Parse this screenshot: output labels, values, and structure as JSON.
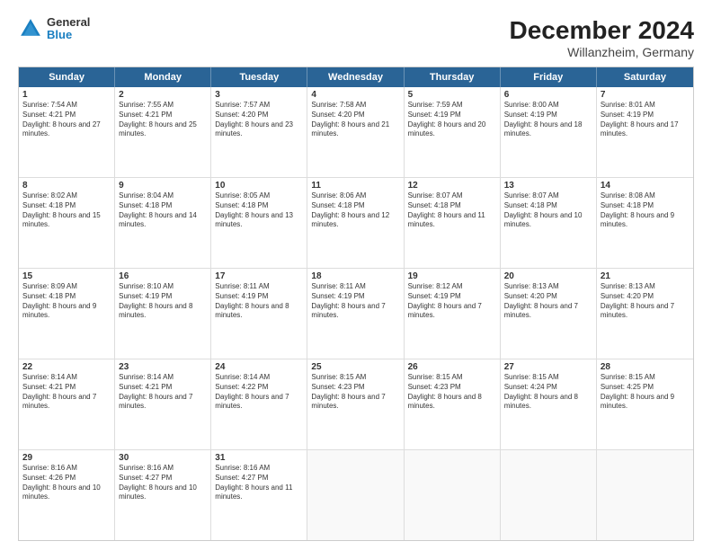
{
  "header": {
    "logo_general": "General",
    "logo_blue": "Blue",
    "title": "December 2024",
    "subtitle": "Willanzheim, Germany"
  },
  "days_of_week": [
    "Sunday",
    "Monday",
    "Tuesday",
    "Wednesday",
    "Thursday",
    "Friday",
    "Saturday"
  ],
  "weeks": [
    [
      {
        "day": "1",
        "sunrise": "Sunrise: 7:54 AM",
        "sunset": "Sunset: 4:21 PM",
        "daylight": "Daylight: 8 hours and 27 minutes."
      },
      {
        "day": "2",
        "sunrise": "Sunrise: 7:55 AM",
        "sunset": "Sunset: 4:21 PM",
        "daylight": "Daylight: 8 hours and 25 minutes."
      },
      {
        "day": "3",
        "sunrise": "Sunrise: 7:57 AM",
        "sunset": "Sunset: 4:20 PM",
        "daylight": "Daylight: 8 hours and 23 minutes."
      },
      {
        "day": "4",
        "sunrise": "Sunrise: 7:58 AM",
        "sunset": "Sunset: 4:20 PM",
        "daylight": "Daylight: 8 hours and 21 minutes."
      },
      {
        "day": "5",
        "sunrise": "Sunrise: 7:59 AM",
        "sunset": "Sunset: 4:19 PM",
        "daylight": "Daylight: 8 hours and 20 minutes."
      },
      {
        "day": "6",
        "sunrise": "Sunrise: 8:00 AM",
        "sunset": "Sunset: 4:19 PM",
        "daylight": "Daylight: 8 hours and 18 minutes."
      },
      {
        "day": "7",
        "sunrise": "Sunrise: 8:01 AM",
        "sunset": "Sunset: 4:19 PM",
        "daylight": "Daylight: 8 hours and 17 minutes."
      }
    ],
    [
      {
        "day": "8",
        "sunrise": "Sunrise: 8:02 AM",
        "sunset": "Sunset: 4:18 PM",
        "daylight": "Daylight: 8 hours and 15 minutes."
      },
      {
        "day": "9",
        "sunrise": "Sunrise: 8:04 AM",
        "sunset": "Sunset: 4:18 PM",
        "daylight": "Daylight: 8 hours and 14 minutes."
      },
      {
        "day": "10",
        "sunrise": "Sunrise: 8:05 AM",
        "sunset": "Sunset: 4:18 PM",
        "daylight": "Daylight: 8 hours and 13 minutes."
      },
      {
        "day": "11",
        "sunrise": "Sunrise: 8:06 AM",
        "sunset": "Sunset: 4:18 PM",
        "daylight": "Daylight: 8 hours and 12 minutes."
      },
      {
        "day": "12",
        "sunrise": "Sunrise: 8:07 AM",
        "sunset": "Sunset: 4:18 PM",
        "daylight": "Daylight: 8 hours and 11 minutes."
      },
      {
        "day": "13",
        "sunrise": "Sunrise: 8:07 AM",
        "sunset": "Sunset: 4:18 PM",
        "daylight": "Daylight: 8 hours and 10 minutes."
      },
      {
        "day": "14",
        "sunrise": "Sunrise: 8:08 AM",
        "sunset": "Sunset: 4:18 PM",
        "daylight": "Daylight: 8 hours and 9 minutes."
      }
    ],
    [
      {
        "day": "15",
        "sunrise": "Sunrise: 8:09 AM",
        "sunset": "Sunset: 4:18 PM",
        "daylight": "Daylight: 8 hours and 9 minutes."
      },
      {
        "day": "16",
        "sunrise": "Sunrise: 8:10 AM",
        "sunset": "Sunset: 4:19 PM",
        "daylight": "Daylight: 8 hours and 8 minutes."
      },
      {
        "day": "17",
        "sunrise": "Sunrise: 8:11 AM",
        "sunset": "Sunset: 4:19 PM",
        "daylight": "Daylight: 8 hours and 8 minutes."
      },
      {
        "day": "18",
        "sunrise": "Sunrise: 8:11 AM",
        "sunset": "Sunset: 4:19 PM",
        "daylight": "Daylight: 8 hours and 7 minutes."
      },
      {
        "day": "19",
        "sunrise": "Sunrise: 8:12 AM",
        "sunset": "Sunset: 4:19 PM",
        "daylight": "Daylight: 8 hours and 7 minutes."
      },
      {
        "day": "20",
        "sunrise": "Sunrise: 8:13 AM",
        "sunset": "Sunset: 4:20 PM",
        "daylight": "Daylight: 8 hours and 7 minutes."
      },
      {
        "day": "21",
        "sunrise": "Sunrise: 8:13 AM",
        "sunset": "Sunset: 4:20 PM",
        "daylight": "Daylight: 8 hours and 7 minutes."
      }
    ],
    [
      {
        "day": "22",
        "sunrise": "Sunrise: 8:14 AM",
        "sunset": "Sunset: 4:21 PM",
        "daylight": "Daylight: 8 hours and 7 minutes."
      },
      {
        "day": "23",
        "sunrise": "Sunrise: 8:14 AM",
        "sunset": "Sunset: 4:21 PM",
        "daylight": "Daylight: 8 hours and 7 minutes."
      },
      {
        "day": "24",
        "sunrise": "Sunrise: 8:14 AM",
        "sunset": "Sunset: 4:22 PM",
        "daylight": "Daylight: 8 hours and 7 minutes."
      },
      {
        "day": "25",
        "sunrise": "Sunrise: 8:15 AM",
        "sunset": "Sunset: 4:23 PM",
        "daylight": "Daylight: 8 hours and 7 minutes."
      },
      {
        "day": "26",
        "sunrise": "Sunrise: 8:15 AM",
        "sunset": "Sunset: 4:23 PM",
        "daylight": "Daylight: 8 hours and 8 minutes."
      },
      {
        "day": "27",
        "sunrise": "Sunrise: 8:15 AM",
        "sunset": "Sunset: 4:24 PM",
        "daylight": "Daylight: 8 hours and 8 minutes."
      },
      {
        "day": "28",
        "sunrise": "Sunrise: 8:15 AM",
        "sunset": "Sunset: 4:25 PM",
        "daylight": "Daylight: 8 hours and 9 minutes."
      }
    ],
    [
      {
        "day": "29",
        "sunrise": "Sunrise: 8:16 AM",
        "sunset": "Sunset: 4:26 PM",
        "daylight": "Daylight: 8 hours and 10 minutes."
      },
      {
        "day": "30",
        "sunrise": "Sunrise: 8:16 AM",
        "sunset": "Sunset: 4:27 PM",
        "daylight": "Daylight: 8 hours and 10 minutes."
      },
      {
        "day": "31",
        "sunrise": "Sunrise: 8:16 AM",
        "sunset": "Sunset: 4:27 PM",
        "daylight": "Daylight: 8 hours and 11 minutes."
      },
      null,
      null,
      null,
      null
    ]
  ]
}
